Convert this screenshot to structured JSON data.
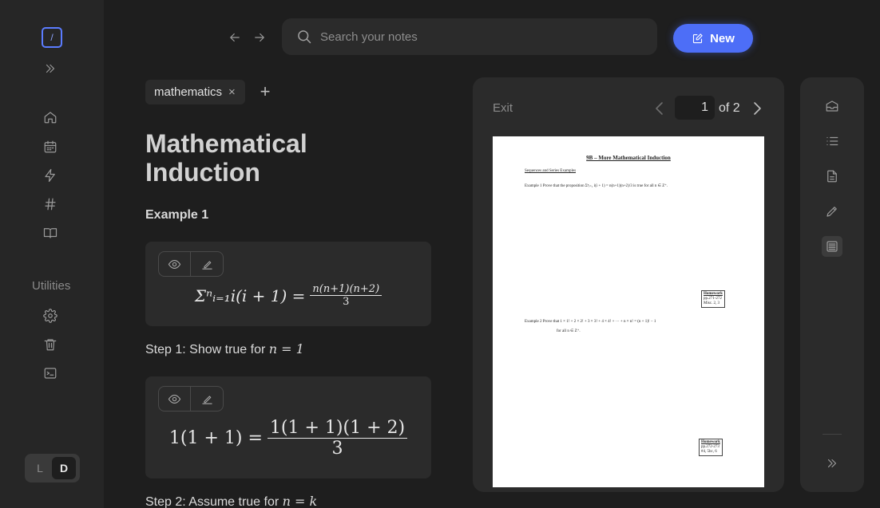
{
  "search": {
    "placeholder": "Search your notes"
  },
  "toolbar": {
    "new_label": "New"
  },
  "sidebar": {
    "logo_glyph": "/",
    "utilities_label": "Utilities",
    "theme": {
      "light": "L",
      "dark": "D",
      "selected": "D"
    }
  },
  "note": {
    "tag": "mathematics",
    "tag_remove": "×",
    "tag_add": "+",
    "title": "Mathematical Induction",
    "heading": "Example 1",
    "steps": [
      {
        "text": "Step 1: Show true for ",
        "math": "n = 1"
      },
      {
        "text": "Step 2: Assume true for ",
        "math": "n = k"
      }
    ],
    "formula1": {
      "lhs": "Σⁿᵢ₌₁i(i + 1) =",
      "num": "n(n+1)(n+2)",
      "den": "3"
    },
    "formula2": {
      "lhs": "1(1 + 1) =",
      "num": "1(1 + 1)(1 + 2)",
      "den": "3"
    }
  },
  "pdf": {
    "exit_label": "Exit",
    "current_page": "1",
    "total_label": "of 2",
    "doc": {
      "title": "9B – More Mathematical Induction",
      "subtitle": "Sequences and Series Examples",
      "ex1": "Example 1   Prove that the proposition  Σⁿᵢ₌₁ i(i + 1) = n(n+1)(n+2)/3  is true for all  n ∈ Z⁺.",
      "hw1": {
        "title": "Homework",
        "line1": "pp.271-272",
        "line2": "Misc. 2, 3"
      },
      "ex2": "Example 2   Prove that  1 × 1! + 2 × 2! + 3 × 3! + 4 × 4! + ··· + n × n! = (n + 1)! − 1",
      "ex2b": "for all  n ∈ Z⁺.",
      "hw2": {
        "title": "Homework",
        "line1": "pp.272-273",
        "line2": "#4, 5bc, 6"
      }
    }
  }
}
